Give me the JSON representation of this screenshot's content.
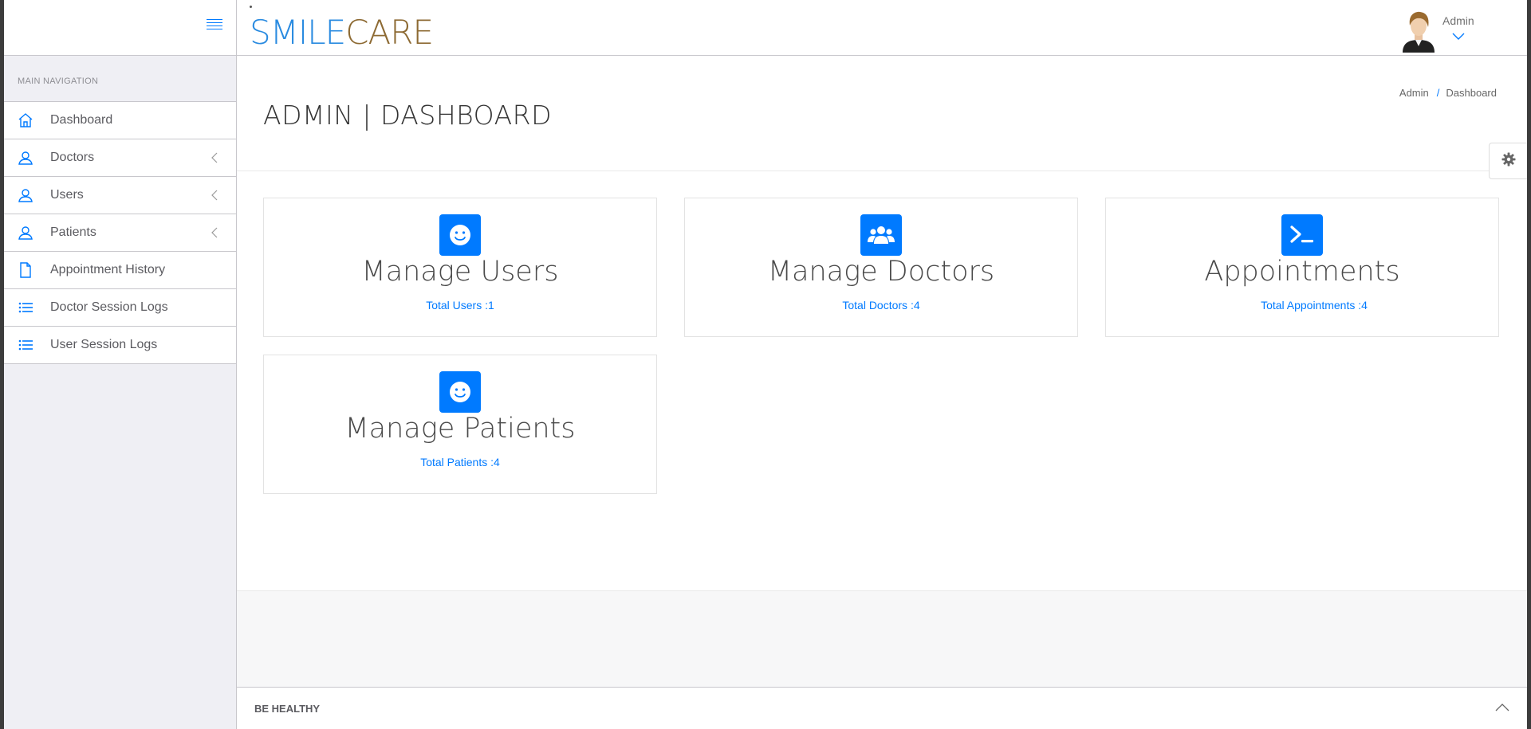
{
  "brand": {
    "part1": "SMILE",
    "part2": "CARE"
  },
  "header": {
    "user_name": "Admin"
  },
  "sidebar": {
    "nav_title": "MAIN NAVIGATION",
    "items": [
      {
        "label": "Dashboard",
        "icon": "home-icon"
      },
      {
        "label": "Doctors",
        "icon": "user-icon"
      },
      {
        "label": "Users",
        "icon": "user-icon"
      },
      {
        "label": "Patients",
        "icon": "user-icon"
      },
      {
        "label": "Appointment History",
        "icon": "file-icon"
      },
      {
        "label": "Doctor Session Logs",
        "icon": "list-icon"
      },
      {
        "label": "User Session Logs",
        "icon": "list-icon"
      }
    ]
  },
  "page": {
    "title": "ADMIN | DASHBOARD",
    "breadcrumb": [
      "Admin",
      "/",
      "Dashboard"
    ]
  },
  "cards": [
    {
      "title": "Manage Users",
      "link": "Total Users :1",
      "icon": "smile-icon"
    },
    {
      "title": "Manage Doctors",
      "link": "Total Doctors :4",
      "icon": "users-group-icon"
    },
    {
      "title": "Appointments",
      "link": "Total Appointments :4",
      "icon": "terminal-icon"
    },
    {
      "title": "Manage Patients",
      "link": "Total Patients :4",
      "icon": "smile-icon"
    }
  ],
  "footer": {
    "text": "BE HEALTHY"
  },
  "colors": {
    "accent": "#007aff",
    "brand_blue": "#2a8be0",
    "brand_brown": "#8d6a33"
  }
}
